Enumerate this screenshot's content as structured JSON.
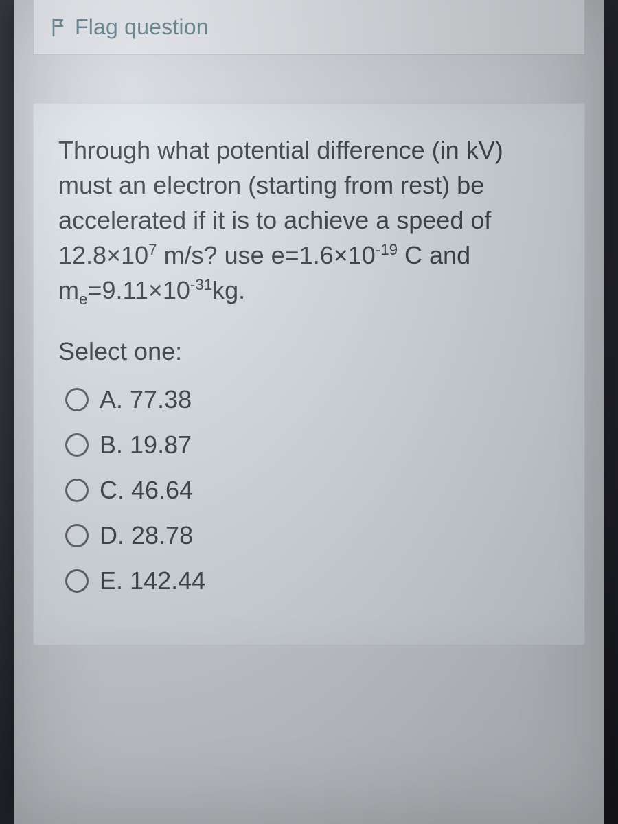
{
  "flag": {
    "label": "Flag question"
  },
  "question": {
    "text_html": "Through what potential difference (in kV) must an electron (starting from rest) be accelerated if it is to achieve a speed of 12.8×10<sup>7</sup> m/s? use e=1.6×10<sup>-19</sup> C and m<sub>e</sub>=9.11×10<sup>-31</sup>kg.",
    "prompt": "Select one:",
    "options": [
      {
        "letter": "A",
        "value": "77.38"
      },
      {
        "letter": "B",
        "value": "19.87"
      },
      {
        "letter": "C",
        "value": "46.64"
      },
      {
        "letter": "D",
        "value": "28.78"
      },
      {
        "letter": "E",
        "value": "142.44"
      }
    ]
  }
}
